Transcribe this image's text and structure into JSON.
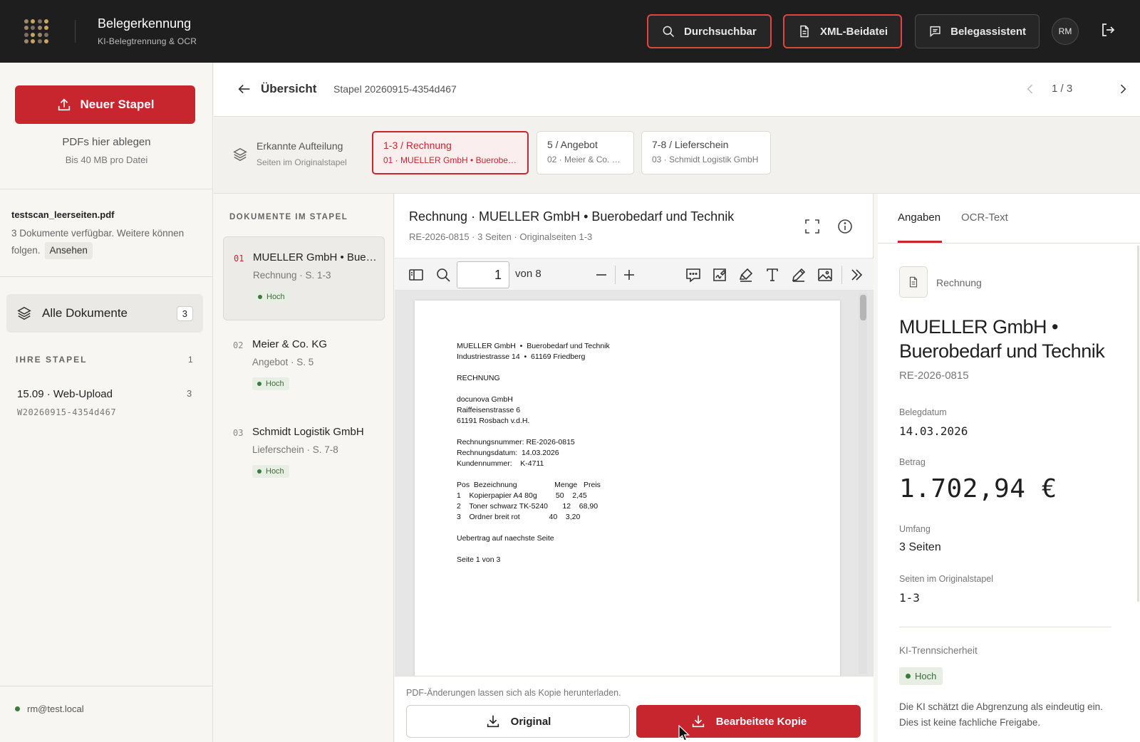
{
  "app": {
    "title": "Belegerkennung",
    "subtitle": "KI-Belegtrennung & OCR",
    "avatar": "RM"
  },
  "topbar": {
    "buttons": [
      {
        "label": "Durchsuchbar",
        "icon": "search-icon"
      },
      {
        "label": "XML-Beidatei",
        "icon": "document-icon"
      },
      {
        "label": "Belegassistent",
        "icon": "chat-icon"
      }
    ]
  },
  "sidebar": {
    "new_batch": "Neuer Stapel",
    "drop_title": "PDFs hier ablegen",
    "drop_sub": "Bis 40 MB pro Datei",
    "file_name": "testscan_leerseiten.pdf",
    "file_info": "3 Dokumente verfügbar. Weitere können folgen.",
    "view_label": "Ansehen",
    "all_docs": "Alle Dokumente",
    "all_docs_count": "3",
    "stapel_head": "IHRE STAPEL",
    "stapel_count": "1",
    "stapel_name": "15.09 · Web-Upload",
    "stapel_num": "3",
    "stapel_id": "W20260915-4354d467",
    "user": "rm@test.local"
  },
  "header": {
    "overview": "Übersicht",
    "stapel": "Stapel 20260915-4354d467",
    "pager": "1 / 3"
  },
  "split": {
    "title": "Erkannte Aufteilung",
    "sub": "Seiten im Originalstapel",
    "chips": [
      {
        "title": "1-3 / Rechnung",
        "sub": "01 · MUELLER GmbH • Buerobed..."
      },
      {
        "title": "5 / Angebot",
        "sub": "02 · Meier & Co. KG"
      },
      {
        "title": "7-8 / Lieferschein",
        "sub": "03 · Schmidt Logistik GmbH"
      }
    ]
  },
  "doclist": {
    "heading": "DOKUMENTE IM STAPEL",
    "items": [
      {
        "num": "01",
        "title": "MUELLER GmbH • Buerobedarf und Technik",
        "sub": "Rechnung · S. 1-3",
        "badge": "Hoch"
      },
      {
        "num": "02",
        "title": "Meier & Co. KG",
        "sub": "Angebot · S. 5",
        "badge": "Hoch"
      },
      {
        "num": "03",
        "title": "Schmidt Logistik GmbH",
        "sub": "Lieferschein · S. 7-8",
        "badge": "Hoch"
      }
    ]
  },
  "viewer": {
    "title": "Rechnung · MUELLER GmbH • Buerobedarf und Technik",
    "sub": "RE-2026-0815 · 3 Seiten · Originalseiten 1-3",
    "page_value": "1",
    "page_of": "von 8",
    "pdf_text": "MUELLER GmbH  •  Buerobedarf und Technik\nIndustriestrasse 14  •  61169 Friedberg\n\nRECHNUNG\n\ndocunova GmbH\nRaiffeisenstrasse 6\n61191 Rosbach v.d.H.\n\nRechnungsnummer: RE-2026-0815\nRechnungsdatum:  14.03.2026\nKundennummer:    K-4711\n\nPos  Bezeichnung                  Menge   Preis\n1    Kopierpapier A4 80g         50    2,45\n2    Toner schwarz TK-5240       12    68,90\n3    Ordner breit rot              40    3,20\n\nUebertrag auf naechste Seite\n\nSeite 1 von 3",
    "note": "PDF-Änderungen lassen sich als Kopie herunterladen.",
    "btn_original": "Original",
    "btn_edited": "Bearbeitete Kopie"
  },
  "details": {
    "tab_details": "Angaben",
    "tab_ocr": "OCR-Text",
    "doc_type": "Rechnung",
    "title": "MUELLER GmbH • Buerobedarf und Technik",
    "ref": "RE-2026-0815",
    "date_label": "Belegdatum",
    "date": "14.03.2026",
    "amount_label": "Betrag",
    "amount": "1.702,94 €",
    "scope_label": "Umfang",
    "scope": "3 Seiten",
    "pages_label": "Seiten im Originalstapel",
    "pages": "1-3",
    "confidence_label": "KI-Trennsicherheit",
    "confidence": "Hoch",
    "note": "Die KI schätzt die Abgrenzung als eindeutig ein. Dies ist keine fachliche Freigabe."
  },
  "colors": {
    "brand_red": "#c7262f",
    "topbar": "#1e1e1e",
    "success": "#3a7a3a"
  }
}
